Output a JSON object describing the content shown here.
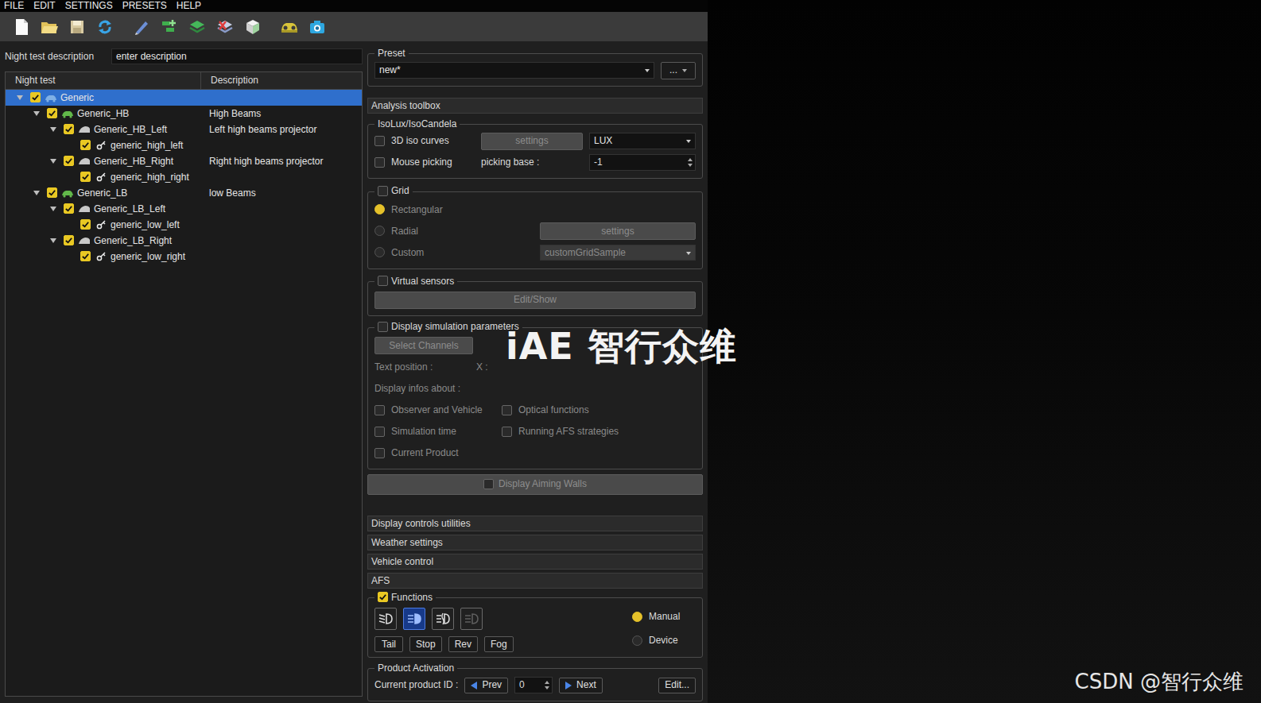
{
  "menu": [
    "FILE",
    "EDIT",
    "SETTINGS",
    "PRESETS",
    "HELP"
  ],
  "description": {
    "label": "Night test description",
    "value": "enter description"
  },
  "tree": {
    "columns": [
      "Night test",
      "Description"
    ],
    "rows": [
      {
        "name": "Generic",
        "kind": "root",
        "checked": true,
        "expanded": true,
        "selected": true,
        "children": [
          {
            "name": "Generic_HB",
            "description": "High Beams",
            "kind": "group",
            "checked": true,
            "expanded": true,
            "selected": false,
            "children": [
              {
                "name": "Generic_HB_Left",
                "description": "Left high beams projector",
                "kind": "projector",
                "checked": true,
                "expanded": true,
                "selected": false,
                "children": [
                  {
                    "name": "generic_high_left",
                    "kind": "beam",
                    "checked": true,
                    "selected": false
                  }
                ]
              },
              {
                "name": "Generic_HB_Right",
                "description": "Right high beams projector",
                "kind": "projector",
                "checked": true,
                "expanded": true,
                "selected": false,
                "children": [
                  {
                    "name": "generic_high_right",
                    "kind": "beam",
                    "checked": true,
                    "selected": false
                  }
                ]
              }
            ]
          },
          {
            "name": "Generic_LB",
            "description": "low Beams",
            "kind": "group",
            "checked": true,
            "expanded": true,
            "selected": false,
            "children": [
              {
                "name": "Generic_LB_Left",
                "kind": "projector",
                "checked": true,
                "expanded": true,
                "selected": false,
                "children": [
                  {
                    "name": "generic_low_left",
                    "kind": "beam",
                    "checked": true,
                    "selected": false
                  }
                ]
              },
              {
                "name": "Generic_LB_Right",
                "kind": "projector",
                "checked": true,
                "expanded": true,
                "selected": false,
                "children": [
                  {
                    "name": "generic_low_right",
                    "kind": "beam",
                    "checked": true,
                    "selected": false
                  }
                ]
              }
            ]
          }
        ]
      }
    ]
  },
  "preset": {
    "title": "Preset",
    "value": "new*",
    "more": "..."
  },
  "toolbox": "Analysis toolbox",
  "isolux": {
    "title": "IsoLux/IsoCandela",
    "iso_curves": {
      "label": "3D iso curves",
      "checked": false
    },
    "settings": {
      "label": "settings",
      "disabled": true
    },
    "unit": "LUX",
    "mouse_picking": {
      "label": "Mouse picking",
      "checked": false
    },
    "picking_base": {
      "label": "picking base :",
      "value": "-1"
    }
  },
  "grid": {
    "label": "Grid",
    "checked": false,
    "options": [
      {
        "label": "Rectangular",
        "selected": true,
        "disabled": true
      },
      {
        "label": "Radial",
        "selected": false,
        "disabled": true
      },
      {
        "label": "Custom",
        "selected": false,
        "disabled": true
      }
    ],
    "radial_settings": {
      "label": "settings",
      "disabled": true
    },
    "custom_value": {
      "value": "customGridSample",
      "disabled": true
    }
  },
  "virtual_sensors": {
    "label": "Virtual sensors",
    "checked": false,
    "button": {
      "label": "Edit/Show",
      "disabled": true
    }
  },
  "sim_params": {
    "label": "Display simulation parameters",
    "checked": false,
    "disabled": true,
    "button": "Select Channels",
    "text_position": "Text position :",
    "x_label": "X :",
    "infos_label": "Display infos about :",
    "infos": [
      {
        "label": "Observer and Vehicle",
        "checked": false
      },
      {
        "label": "Optical functions",
        "checked": false
      },
      {
        "label": "Simulation time",
        "checked": false
      },
      {
        "label": "Running AFS strategies",
        "checked": false
      },
      {
        "label": "Current Product",
        "checked": false
      }
    ]
  },
  "aiming_walls": {
    "label": "Display Aiming Walls",
    "checked": false,
    "disabled": true
  },
  "sections": [
    "Display controls utilities",
    "Weather settings",
    "Vehicle control",
    "AFS"
  ],
  "functions": {
    "label": "Functions",
    "checked": true,
    "buttons": [
      {
        "kind": "low-beam",
        "selected": false
      },
      {
        "kind": "high-beam",
        "selected": true
      },
      {
        "kind": "fog",
        "selected": false
      },
      {
        "kind": "off",
        "selected": false
      }
    ],
    "lights": [
      "Tail",
      "Stop",
      "Rev",
      "Fog"
    ],
    "modes": [
      {
        "label": "Manual",
        "selected": true
      },
      {
        "label": "Device",
        "selected": false
      }
    ]
  },
  "product": {
    "title": "Product Activation",
    "label": "Current product ID :",
    "prev": "Prev",
    "value": "0",
    "next": "Next",
    "edit": "Edit..."
  },
  "watermarks": [
    {
      "text": "iAE 智行众维"
    },
    {
      "text": "CSDN @智行众维"
    }
  ]
}
